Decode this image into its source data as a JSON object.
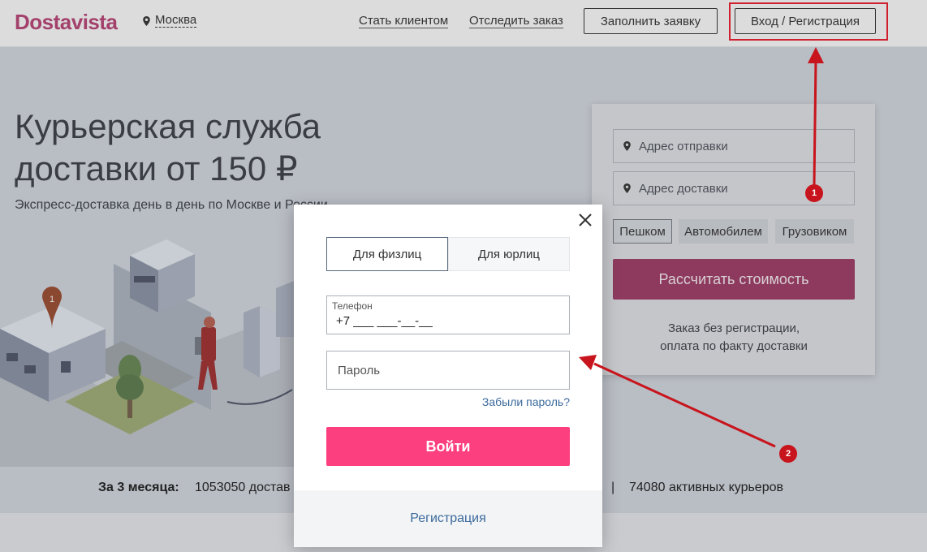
{
  "header": {
    "logo": "Dostavista",
    "city": "Москва",
    "nav": [
      "Стать клиентом",
      "Отследить заказ"
    ],
    "fill_request": "Заполнить заявку",
    "login_register": "Вход / Регистрация"
  },
  "hero": {
    "title_line1": "Курьерская служба",
    "title_line2": "доставки от 150 ₽",
    "subtitle": "Экспресс-доставка день в день по Москве и России"
  },
  "illustration": {
    "badge": "1"
  },
  "calculator": {
    "from_placeholder": "Адрес отправки",
    "to_placeholder": "Адрес доставки",
    "modes": [
      "Пешком",
      "Автомобилем",
      "Грузовиком"
    ],
    "active_mode": "Пешком",
    "button": "Рассчитать стоимость",
    "note_line1": "Заказ без регистрации,",
    "note_line2": "оплата по факту доставки"
  },
  "stats": {
    "label": "За 3 месяца:",
    "deliveries": "1053050 достав",
    "separator": "|",
    "couriers": "74080 активных курьеров"
  },
  "modal": {
    "tabs": [
      "Для физлиц",
      "Для юрлиц"
    ],
    "active_tab": "Для физлиц",
    "phone_label": "Телефон",
    "phone_value": "+7 ___ ___-__-__",
    "password_placeholder": "Пароль",
    "forgot": "Забыли пароль?",
    "login_button": "Войти",
    "register": "Регистрация"
  },
  "annotations": {
    "marker1": "1",
    "marker2": "2"
  },
  "colors": {
    "brand": "#a3406b",
    "login_button": "#fc3f7e",
    "link": "#3b6a9c",
    "annotation": "#c8141c"
  }
}
